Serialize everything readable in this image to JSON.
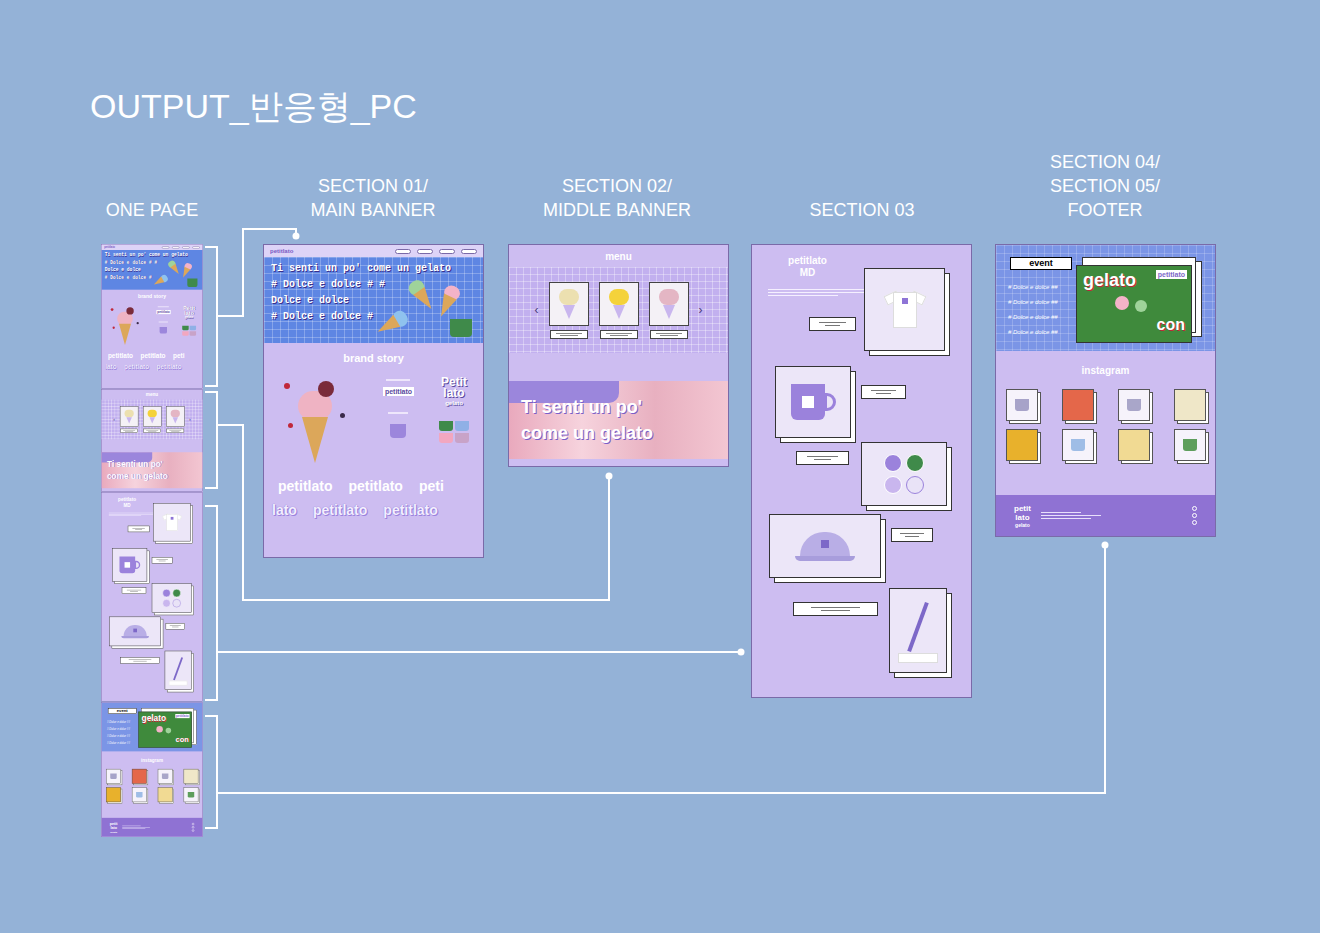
{
  "title": "OUTPUT_반응형_PC",
  "labels": [
    {
      "lines": [
        "ONE PAGE"
      ]
    },
    {
      "lines": [
        "SECTION 01/",
        "MAIN BANNER"
      ]
    },
    {
      "lines": [
        "SECTION 02/",
        "MIDDLE BANNER"
      ]
    },
    {
      "lines": [
        "SECTION 03"
      ]
    },
    {
      "lines": [
        "SECTION 04/",
        "SECTION 05/",
        "FOOTER"
      ]
    }
  ],
  "site": {
    "logo": "petitlato",
    "main_banner": {
      "lines": [
        "Ti senti un po' come un gelato",
        "# Dolce e dolce # #",
        "Dolce e dolce",
        "# Dolce e dolce #"
      ]
    },
    "brand_story": {
      "title": "brand story",
      "wordmark": "petitlato",
      "logo": [
        "Petit",
        "lato",
        "gelato"
      ],
      "swatches": [
        {
          "color": "#3f8a4a"
        },
        {
          "color": "#8fb0e6"
        },
        {
          "color": "#f2a7c0"
        },
        {
          "color": "#c8a3c8"
        }
      ],
      "marquee": [
        [
          "petitlato",
          "petitlato",
          "peti"
        ],
        [
          "lato",
          "petitlato",
          "petitlato"
        ]
      ]
    },
    "menu": {
      "title": "menu",
      "prev": "‹",
      "next": "›",
      "items": [
        {
          "color": "#ece0b0"
        },
        {
          "color": "#f4d23a"
        },
        {
          "color": "#e4b6c4"
        }
      ]
    },
    "middle_banner": {
      "lines": [
        "Ti senti un po'",
        "come un gelato"
      ]
    },
    "md": {
      "title": [
        "petitlato",
        "MD"
      ],
      "products": [
        {
          "kind": "tshirt"
        },
        {
          "kind": "mug"
        },
        {
          "kind": "badges"
        },
        {
          "kind": "cap"
        },
        {
          "kind": "pen"
        }
      ]
    },
    "event": {
      "label": "event",
      "tags": [
        "# Dolce e dolce ##",
        "# Dolce e dolce ##",
        "# Dolce e dolce ##",
        "# Dolce e dolce ##"
      ],
      "poster": {
        "title": "gelato",
        "subtitle": "con",
        "badge": "petitlato"
      }
    },
    "instagram": {
      "title": "instagram",
      "posts": [
        {
          "kind": "file",
          "color": "#a7a3c9"
        },
        {
          "kind": "photo",
          "color": "#e4674a"
        },
        {
          "kind": "file",
          "color": "#a9a6c9"
        },
        {
          "kind": "photo",
          "color": "#efe7c8"
        },
        {
          "kind": "photo",
          "color": "#e8b12c"
        },
        {
          "kind": "file",
          "color": "#9fbde6"
        },
        {
          "kind": "photo",
          "color": "#f1da93"
        },
        {
          "kind": "file",
          "color": "#5e9e5c"
        }
      ]
    },
    "footer": {
      "logo": [
        "petit",
        "lato",
        "gelato"
      ]
    }
  }
}
